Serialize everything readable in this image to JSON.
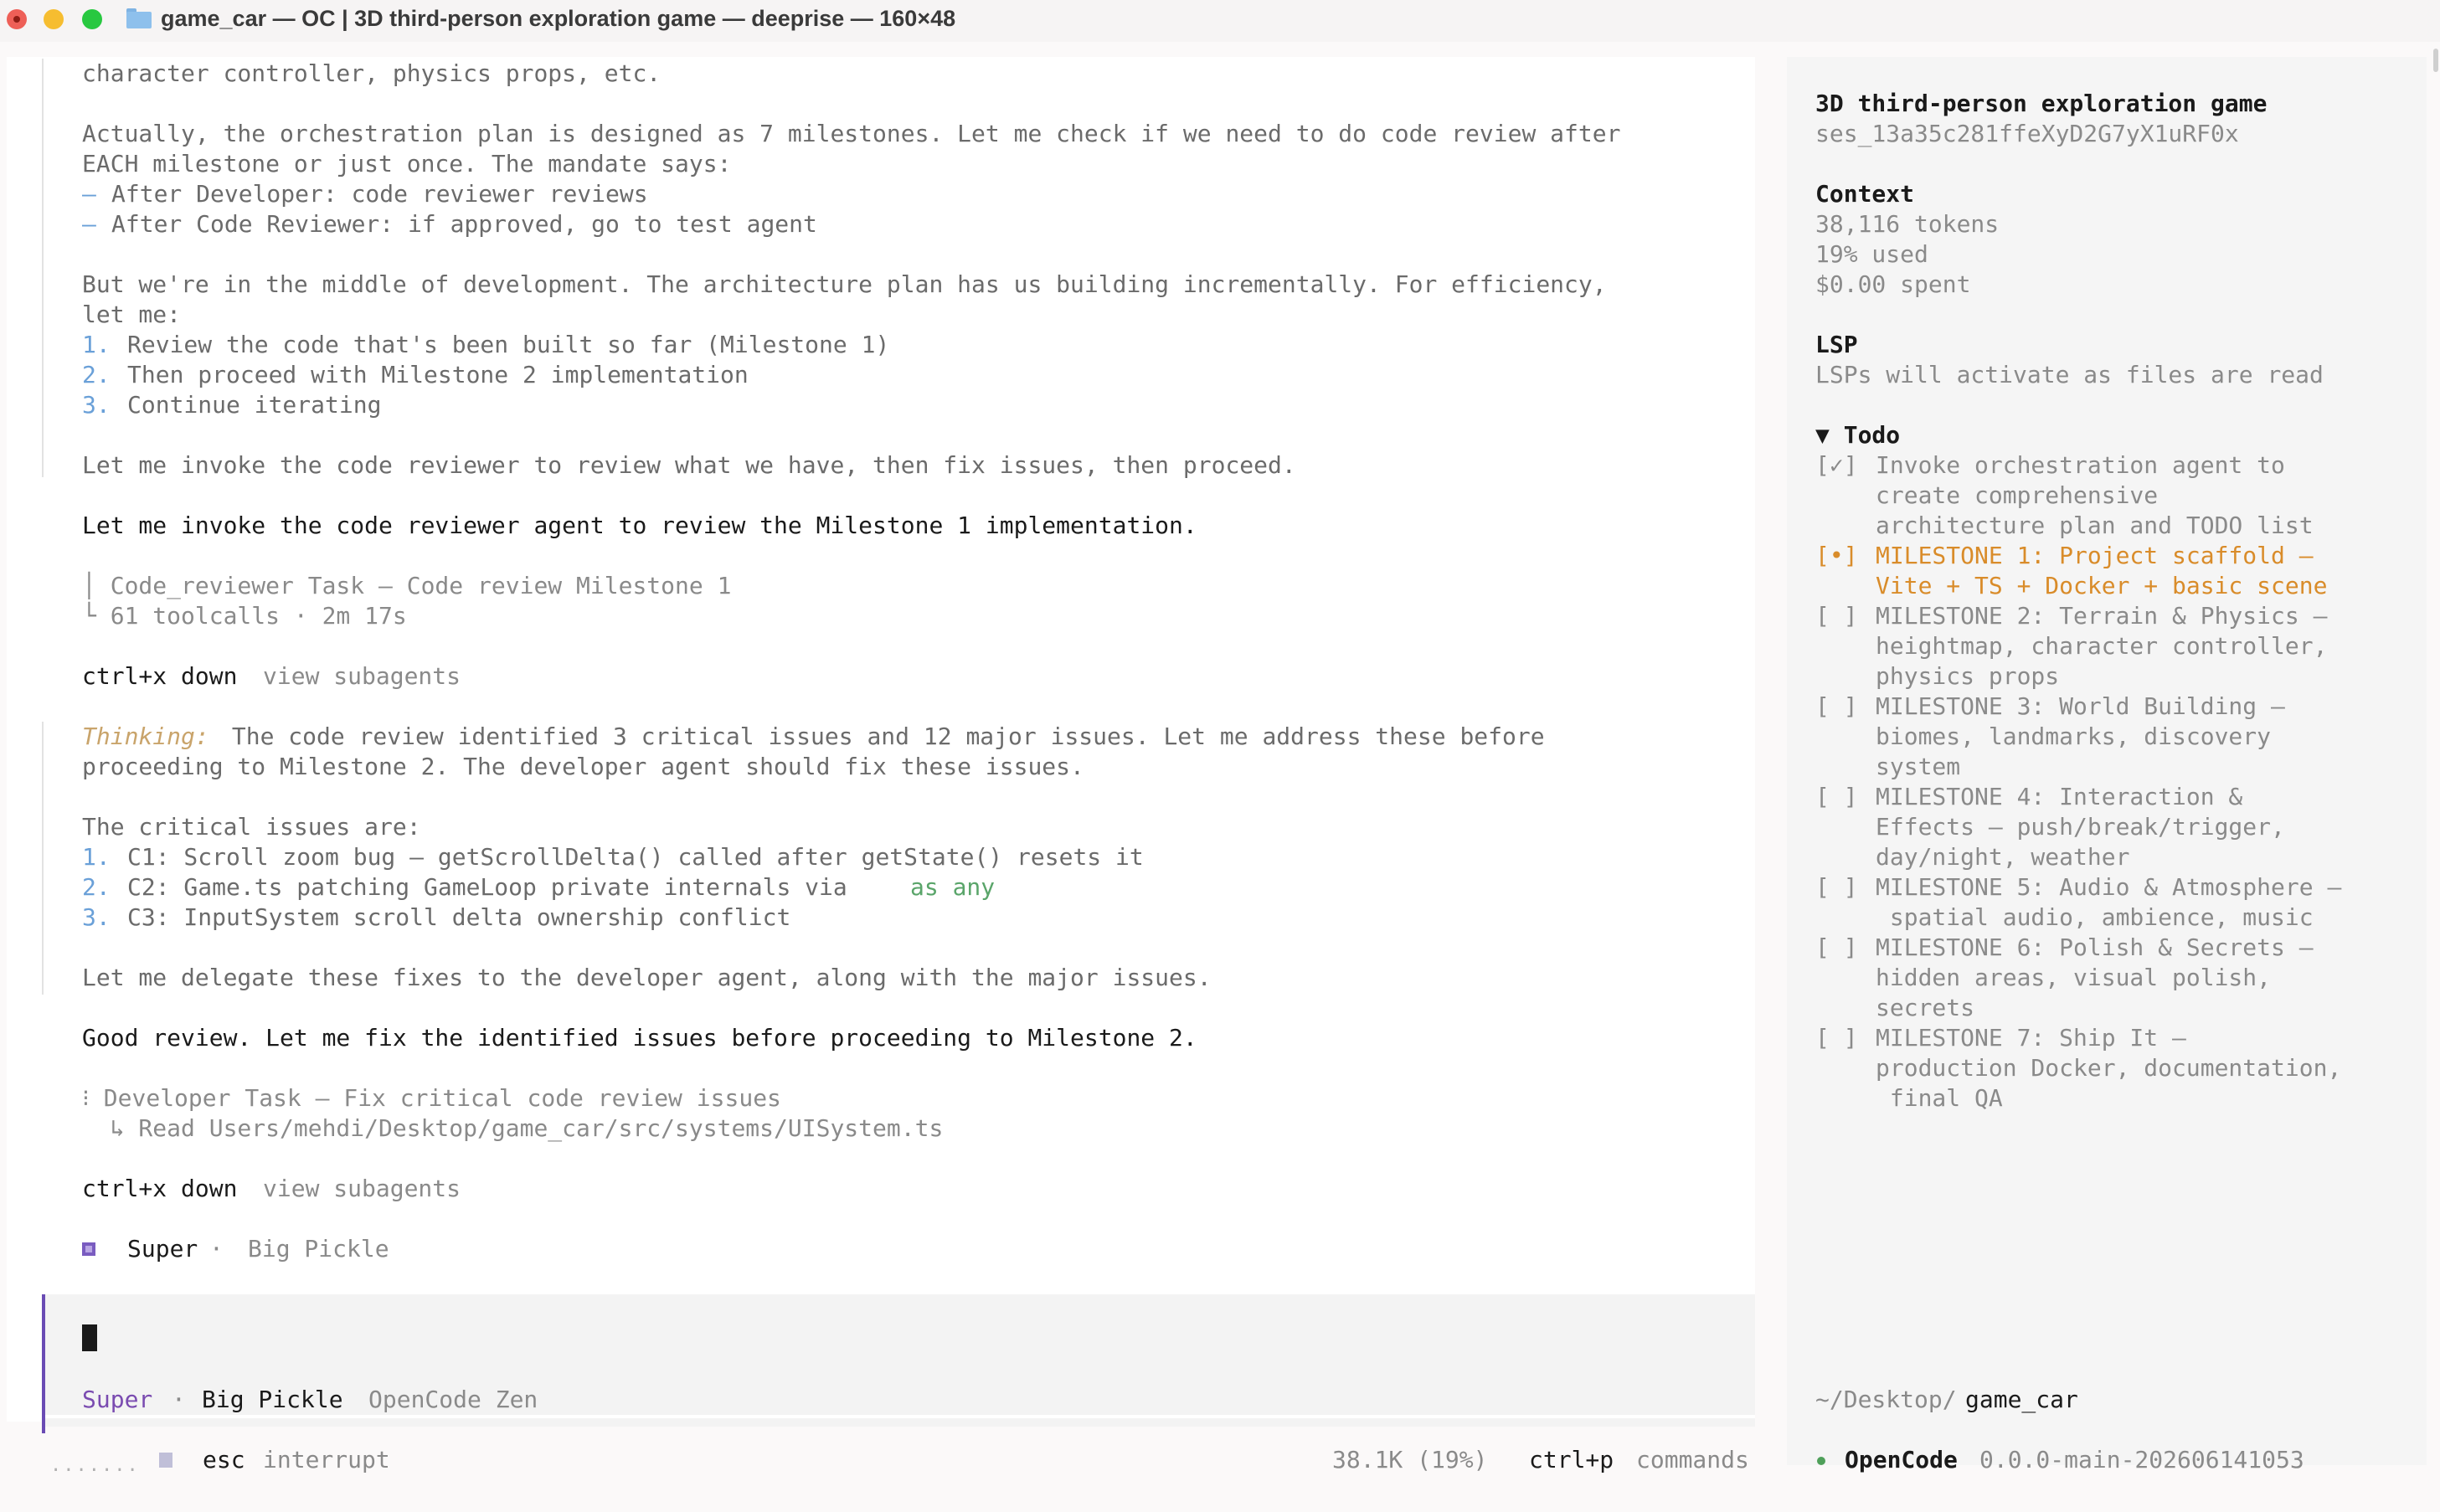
{
  "window": {
    "title": "game_car — OC | 3D third-person exploration game — deeprise — 160×48"
  },
  "transcript": {
    "line_01": "character controller, physics props, etc.",
    "line_02": "Actually, the orchestration plan is designed as 7 milestones. Let me check if we need to do code review after",
    "line_03": "EACH milestone or just once. The mandate says:",
    "bullet_dash": "–",
    "line_04": "After Developer: code reviewer reviews",
    "line_05": "After Code Reviewer: if approved, go to test agent",
    "line_06": "But we're in the middle of development. The architecture plan has us building incrementally. For efficiency,",
    "line_07": "let me:",
    "num_1": "1.",
    "num_2": "2.",
    "num_3": "3.",
    "line_08": "Review the code that's been built so far (Milestone 1)",
    "line_09": "Then proceed with Milestone 2 implementation",
    "line_10": "Continue iterating",
    "line_11": "Let me invoke the code reviewer to review what we have, then fix issues, then proceed.",
    "line_12": "Let me invoke the code reviewer agent to review the Milestone 1 implementation.",
    "task1_title": "│ Code_reviewer Task — Code review Milestone 1",
    "task1_meta": "└ 61 toolcalls · 2m 17s",
    "shortcut_key": "ctrl+x down",
    "shortcut_label": "view subagents",
    "thinking_label": "Thinking:",
    "thinking_1": " The code review identified 3 critical issues and 12 major issues. Let me address these before",
    "thinking_2": "proceeding to Milestone 2. The developer agent should fix these issues.",
    "line_13": "The critical issues are:",
    "issue_1": "C1: Scroll zoom bug — getScrollDelta() called after getState() resets it",
    "issue_2_a": "C2: Game.ts patching GameLoop private internals via ",
    "issue_2_b": "as any",
    "issue_3": "C3: InputSystem scroll delta ownership conflict",
    "line_14": "Let me delegate these fixes to the developer agent, along with the major issues.",
    "line_15": "Good review. Let me fix the identified issues before proceeding to Milestone 2.",
    "task2_title": "⁝ Developer Task — Fix critical code review issues",
    "task2_meta": "  ↳ Read Users/mehdi/Desktop/game_car/src/systems/UISystem.ts",
    "agent_name": "Super",
    "agent_sep": "·",
    "agent_model": "Big Pickle"
  },
  "input": {
    "agent": "Super",
    "sep": "·",
    "model": "Big Pickle",
    "provider": "OpenCode Zen"
  },
  "statusbar": {
    "dots": "·······",
    "esc_key": "esc",
    "esc_label": "interrupt",
    "tokens": "38.1K (19%)",
    "cmd_key": "ctrl+p",
    "cmd_label": "commands"
  },
  "sidebar": {
    "session_title": "3D third-person exploration game",
    "session_id": "ses_13a35c281ffeXyD2G7yX1uRF0x",
    "context_heading": "Context",
    "context_tokens": "38,116 tokens",
    "context_used": "19% used",
    "context_spent": "$0.00 spent",
    "lsp_heading": "LSP",
    "lsp_text": "LSPs will activate as files are read",
    "todo_heading": "▼ Todo",
    "todos": [
      {
        "mark": "[✓]",
        "lines": [
          "Invoke orchestration agent to",
          "create comprehensive",
          "architecture plan and TODO list"
        ],
        "state": "done"
      },
      {
        "mark": "[•]",
        "lines": [
          "MILESTONE 1: Project scaffold –",
          "Vite + TS + Docker + basic scene"
        ],
        "state": "active"
      },
      {
        "mark": "[ ]",
        "lines": [
          "MILESTONE 2: Terrain & Physics –",
          "heightmap, character controller,",
          "physics props"
        ],
        "state": "pending"
      },
      {
        "mark": "[ ]",
        "lines": [
          "MILESTONE 3: World Building –",
          "biomes, landmarks, discovery",
          "system"
        ],
        "state": "pending"
      },
      {
        "mark": "[ ]",
        "lines": [
          "MILESTONE 4: Interaction &",
          "Effects – push/break/trigger,",
          "day/night, weather"
        ],
        "state": "pending"
      },
      {
        "mark": "[ ]",
        "lines": [
          "MILESTONE 5: Audio & Atmosphere –",
          " spatial audio, ambience, music"
        ],
        "state": "pending"
      },
      {
        "mark": "[ ]",
        "lines": [
          "MILESTONE 6: Polish & Secrets –",
          "hidden areas, visual polish,",
          "secrets"
        ],
        "state": "pending"
      },
      {
        "mark": "[ ]",
        "lines": [
          "MILESTONE 7: Ship It –",
          "production Docker, documentation,",
          " final QA"
        ],
        "state": "pending"
      }
    ],
    "cwd_prefix": "~/Desktop/",
    "cwd_dir": "game_car",
    "app_name": "OpenCode",
    "app_version": "0.0.0-main-202606141053"
  },
  "colors": {
    "accent_purple": "#6a4bb4",
    "todo_active": "#d98c2a",
    "list_number": "#6aa0d8",
    "code_green": "#5aa56a"
  }
}
